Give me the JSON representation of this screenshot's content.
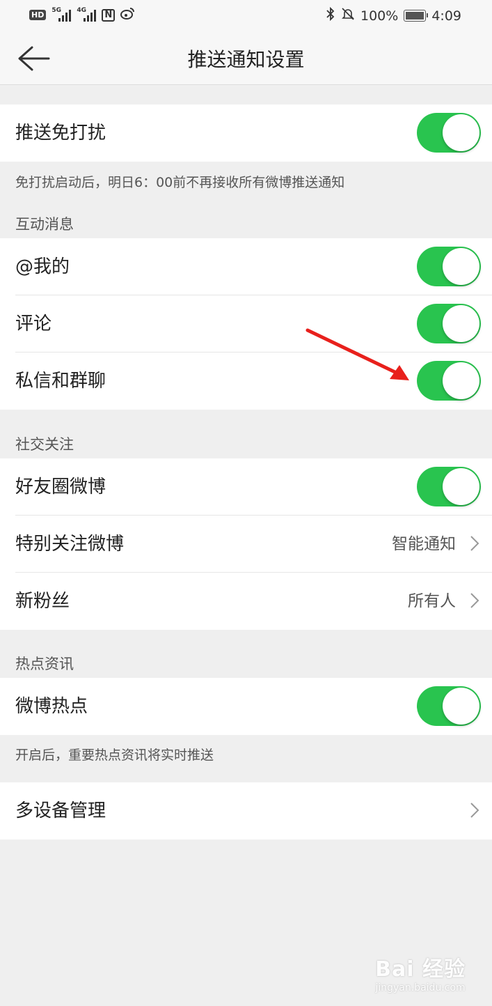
{
  "status_bar": {
    "badge": "HD",
    "signal1_label": "5G",
    "signal2_label": "4G",
    "nfc": "N",
    "battery": "100%",
    "time": "4:09"
  },
  "nav": {
    "title": "推送通知设置"
  },
  "dnd": {
    "label": "推送免打扰",
    "enabled": true,
    "note": "免打扰启动后，明日6：00前不再接收所有微博推送通知"
  },
  "sections": {
    "interaction": "互动消息",
    "social": "社交关注",
    "hot": "热点资讯"
  },
  "interaction_items": [
    {
      "label": "@我的",
      "enabled": true
    },
    {
      "label": "评论",
      "enabled": true
    },
    {
      "label": "私信和群聊",
      "enabled": true
    }
  ],
  "social_items": [
    {
      "label": "好友圈微博",
      "enabled": true
    },
    {
      "label": "特别关注微博",
      "value": "智能通知"
    },
    {
      "label": "新粉丝",
      "value": "所有人"
    }
  ],
  "hot_items": [
    {
      "label": "微博热点",
      "enabled": true
    }
  ],
  "hot_note": "开启后，重要热点资讯将实时推送",
  "multi_device": {
    "label": "多设备管理"
  },
  "watermark": {
    "main": "Bai 经验",
    "sub": "jingyan.baidu.com"
  },
  "colors": {
    "toggle_on": "#29c44f",
    "annotation_arrow": "#e8201c"
  }
}
